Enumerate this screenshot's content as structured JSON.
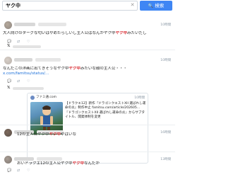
{
  "search": {
    "value": "ヤク中",
    "button_label": "検索"
  },
  "tweets": [
    {
      "time": "10時間",
      "text_before": "大人向けのターグな匂いはやめたらしいし主人公はなんかヤク中",
      "highlight": "ヤク中",
      "text_after": "みたいだし"
    },
    {
      "time": "10時間",
      "text_before": "なんだこの洋画に出てきそうなヤク中",
      "highlight": "ヤク中",
      "text_after": "みたいな顔の主人公・・・",
      "link": "x.com/famitsu/status/..."
    },
    {
      "time": "16時間",
      "text_before": "12の主人公ヤク中",
      "highlight": "ヤク中",
      "text_after": "やばいな"
    },
    {
      "time": "13時間",
      "text_before": "おいドラクエ12の主人公ヤク中",
      "highlight": "ヤク中",
      "text_after": "なんだが"
    }
  ],
  "quote": {
    "name": "ファミ通.com",
    "time": "10時間",
    "text_part1": "【ドラクエ12】新作『ドラゴンクエストXII 選ばれし運命の炎』制作中止 famitsu.com/article/202605... 『ドラゴンクエストXII 選ばれし運命の炎』からサブタイトル、開発体制を変更",
    "link": "famitsu.com/article/202605..."
  },
  "icons": {
    "clear": "close-icon",
    "search": "search-icon",
    "brand": "x-logo-icon"
  }
}
